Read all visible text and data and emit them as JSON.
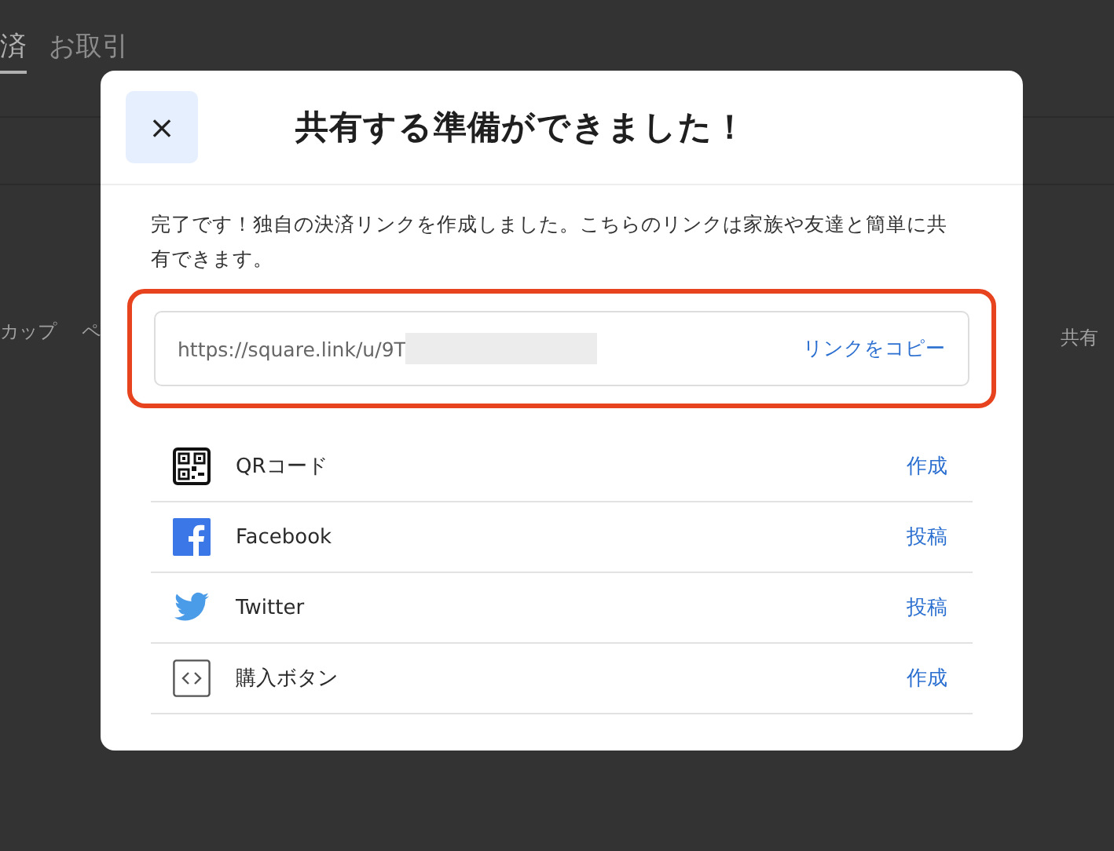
{
  "background_page": {
    "tabs": [
      {
        "label": "済",
        "selected": true
      },
      {
        "label": "お取引",
        "selected": false
      }
    ],
    "row_texts": [
      "カップ",
      "ペ"
    ],
    "share_label": "共有"
  },
  "dialog": {
    "close_label": "×",
    "title": "共有する準備ができました！",
    "message": "完了です！独自の決済リンクを作成しました。こちらのリンクは家族や友達と簡単に共有できます。",
    "link": {
      "url": "https://square.link/u/9T",
      "redacted": true,
      "copy_label": "リンクをコピー",
      "highlighted": true
    },
    "share_options": [
      {
        "kind": "qr",
        "label": "QRコード",
        "action": "作成"
      },
      {
        "kind": "facebook",
        "label": "Facebook",
        "action": "投稿"
      },
      {
        "kind": "twitter",
        "label": "Twitter",
        "action": "投稿"
      },
      {
        "kind": "embed",
        "label": "購入ボタン",
        "action": "作成"
      }
    ]
  }
}
